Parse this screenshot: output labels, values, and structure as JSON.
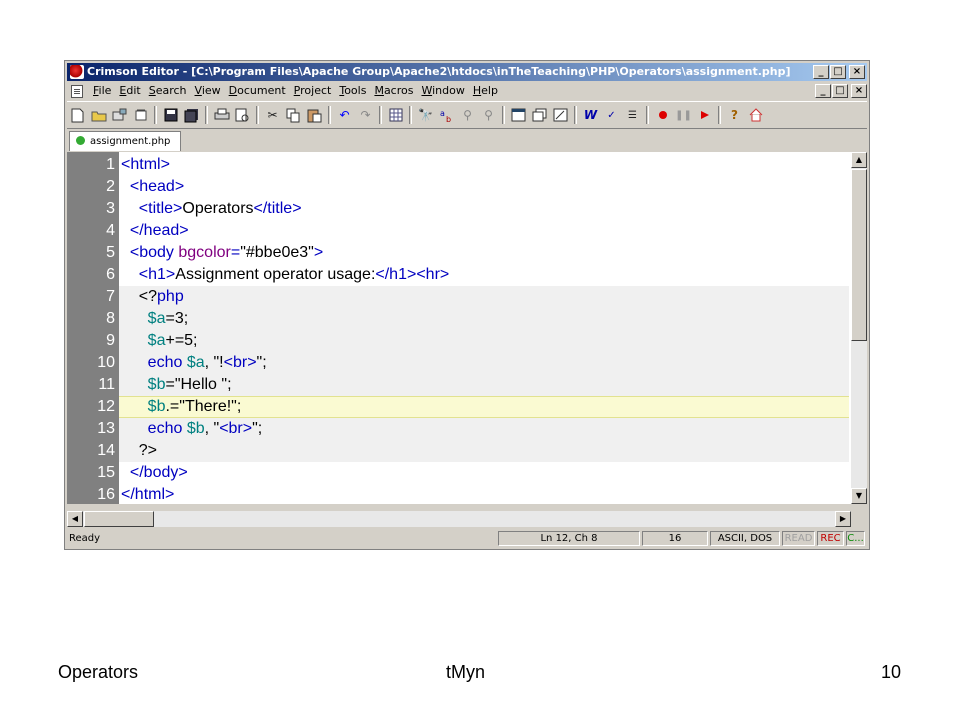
{
  "window": {
    "title": "Crimson Editor - [C:\\Program Files\\Apache Group\\Apache2\\htdocs\\inTheTeaching\\PHP\\Operators\\assignment.php]",
    "buttons": {
      "minimize": "_",
      "maximize": "□",
      "close": "×"
    }
  },
  "menu": {
    "items": [
      {
        "pre": "",
        "ul": "F",
        "post": "ile"
      },
      {
        "pre": "",
        "ul": "E",
        "post": "dit"
      },
      {
        "pre": "",
        "ul": "S",
        "post": "earch"
      },
      {
        "pre": "",
        "ul": "V",
        "post": "iew"
      },
      {
        "pre": "",
        "ul": "D",
        "post": "ocument"
      },
      {
        "pre": "",
        "ul": "P",
        "post": "roject"
      },
      {
        "pre": "",
        "ul": "T",
        "post": "ools"
      },
      {
        "pre": "",
        "ul": "M",
        "post": "acros"
      },
      {
        "pre": "",
        "ul": "W",
        "post": "indow"
      },
      {
        "pre": "",
        "ul": "H",
        "post": "elp"
      }
    ]
  },
  "tab": {
    "label": "assignment.php"
  },
  "editor": {
    "current_line": 12,
    "lines": [
      {
        "n": "1",
        "php": false,
        "segs": [
          [
            "tag",
            "<html>"
          ]
        ]
      },
      {
        "n": "2",
        "php": false,
        "segs": [
          [
            "txt",
            "  "
          ],
          [
            "tag",
            "<head>"
          ]
        ]
      },
      {
        "n": "3",
        "php": false,
        "segs": [
          [
            "txt",
            "    "
          ],
          [
            "tag",
            "<title>"
          ],
          [
            "txt",
            "Operators"
          ],
          [
            "tag",
            "</title>"
          ]
        ]
      },
      {
        "n": "4",
        "php": false,
        "segs": [
          [
            "txt",
            "  "
          ],
          [
            "tag",
            "</head>"
          ]
        ]
      },
      {
        "n": "5",
        "php": false,
        "segs": [
          [
            "txt",
            "  "
          ],
          [
            "tag",
            "<body "
          ],
          [
            "attr",
            "bgcolor"
          ],
          [
            "tag",
            "="
          ],
          [
            "str",
            "\"#bbe0e3\""
          ],
          [
            "tag",
            ">"
          ]
        ]
      },
      {
        "n": "6",
        "php": false,
        "segs": [
          [
            "txt",
            "    "
          ],
          [
            "tag",
            "<h1>"
          ],
          [
            "txt",
            "Assignment operator usage:"
          ],
          [
            "tag",
            "</h1>"
          ],
          [
            "tag",
            "<hr>"
          ]
        ]
      },
      {
        "n": "7",
        "php": true,
        "segs": [
          [
            "txt",
            "    <?"
          ],
          [
            "kw",
            "php"
          ]
        ]
      },
      {
        "n": "8",
        "php": true,
        "segs": [
          [
            "txt",
            "      "
          ],
          [
            "var",
            "$a"
          ],
          [
            "txt",
            "=3;"
          ]
        ]
      },
      {
        "n": "9",
        "php": true,
        "segs": [
          [
            "txt",
            "      "
          ],
          [
            "var",
            "$a"
          ],
          [
            "txt",
            "+=5;"
          ]
        ]
      },
      {
        "n": "10",
        "php": true,
        "segs": [
          [
            "txt",
            "      "
          ],
          [
            "kw",
            "echo "
          ],
          [
            "var",
            "$a"
          ],
          [
            "txt",
            ", \"!"
          ],
          [
            "tag",
            "<br>"
          ],
          [
            "txt",
            "\";"
          ]
        ]
      },
      {
        "n": "11",
        "php": true,
        "segs": [
          [
            "txt",
            "      "
          ],
          [
            "var",
            "$b"
          ],
          [
            "txt",
            "=\"Hello \";"
          ]
        ]
      },
      {
        "n": "12",
        "php": true,
        "segs": [
          [
            "txt",
            "      "
          ],
          [
            "var",
            "$b"
          ],
          [
            "txt",
            ".=\"There!\";"
          ]
        ]
      },
      {
        "n": "13",
        "php": true,
        "segs": [
          [
            "txt",
            "      "
          ],
          [
            "kw",
            "echo "
          ],
          [
            "var",
            "$b"
          ],
          [
            "txt",
            ", \""
          ],
          [
            "tag",
            "<br>"
          ],
          [
            "txt",
            "\";"
          ]
        ]
      },
      {
        "n": "14",
        "php": true,
        "segs": [
          [
            "txt",
            "    ?>"
          ]
        ]
      },
      {
        "n": "15",
        "php": false,
        "segs": [
          [
            "txt",
            "  "
          ],
          [
            "tag",
            "</body>"
          ]
        ]
      },
      {
        "n": "16",
        "php": false,
        "segs": [
          [
            "tag",
            "</html>"
          ]
        ]
      }
    ]
  },
  "status": {
    "ready": "Ready",
    "position": "Ln 12, Ch 8",
    "count": "16",
    "encoding": "ASCII, DOS",
    "read": "READ",
    "rec": "REC",
    "col": "C..."
  },
  "footer": {
    "left": "Operators",
    "center": "tMyn",
    "right": "10"
  }
}
